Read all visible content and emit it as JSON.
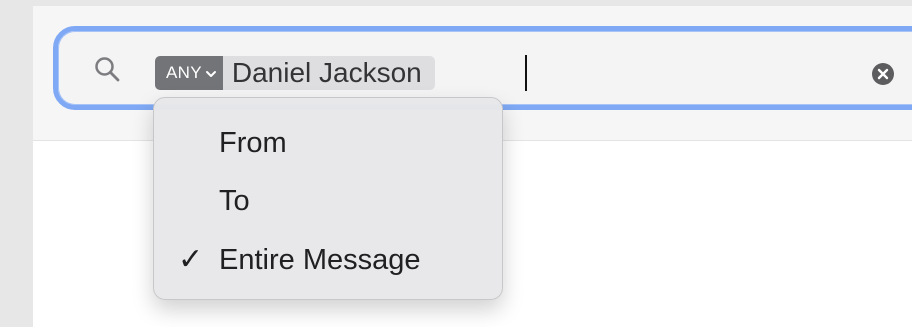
{
  "search": {
    "scope_label": "ANY",
    "token_value": "Daniel Jackson",
    "typed_text": "",
    "icon": "search-icon",
    "clear_icon": "clear-icon",
    "accent_color": "#7fa9f4"
  },
  "dropdown": {
    "items": [
      {
        "label": "From",
        "selected": false
      },
      {
        "label": "To",
        "selected": false
      },
      {
        "label": "Entire Message",
        "selected": true,
        "check_mark": "✓"
      }
    ]
  },
  "colors": {
    "scope_badge": "#737477",
    "token_background": "#dedee1",
    "menu_background": "#e8e8ea"
  }
}
